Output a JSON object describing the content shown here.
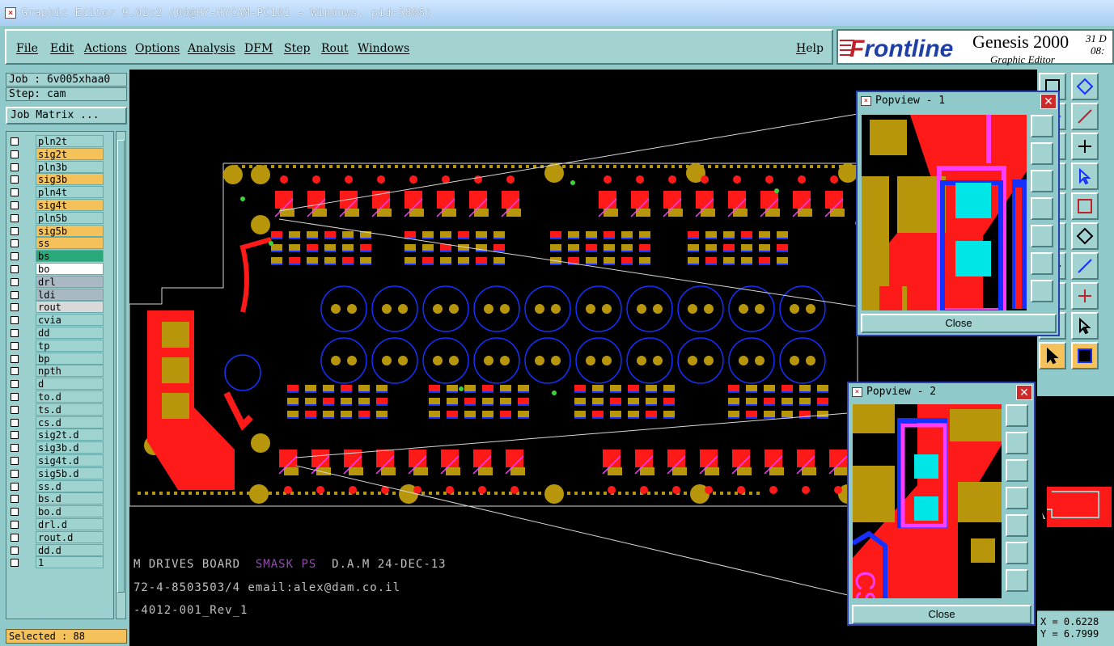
{
  "window": {
    "title": "Graphic Editor 9.02c2 (00@HY-HYCAM-PC101 - Windows, pid:5808)"
  },
  "menu": {
    "items": [
      "File",
      "Edit",
      "Actions",
      "Options",
      "Analysis",
      "DFM",
      "Step",
      "Rout",
      "Windows"
    ],
    "help": "Help"
  },
  "logo": {
    "brand_first": "F",
    "brand_rest": "rontline",
    "product": "Genesis 2000",
    "subtitle": "Graphic Editor",
    "date_line1": "31 D",
    "date_line2": "08:"
  },
  "job": {
    "job_label": "Job : 6v005xhaa0",
    "step_label": "Step: cam",
    "matrix_button": "Job Matrix ..."
  },
  "layers": [
    {
      "name": "pln2t",
      "color": "#9ed3d0"
    },
    {
      "name": "sig2t",
      "color": "#f4c15b"
    },
    {
      "name": "pln3b",
      "color": "#9ed3d0"
    },
    {
      "name": "sig3b",
      "color": "#f4c15b"
    },
    {
      "name": "pln4t",
      "color": "#9ed3d0"
    },
    {
      "name": "sig4t",
      "color": "#f4c15b"
    },
    {
      "name": "pln5b",
      "color": "#9ed3d0"
    },
    {
      "name": "sig5b",
      "color": "#f4c15b"
    },
    {
      "name": "ss",
      "color": "#f4c15b"
    },
    {
      "name": "bs",
      "color": "#2aa87a"
    },
    {
      "name": "bo",
      "color": "#ffffff"
    },
    {
      "name": "drl",
      "color": "#a9b9c4"
    },
    {
      "name": "ldi",
      "color": "#a9b9c4"
    },
    {
      "name": "rout",
      "color": "#d9d9d9"
    },
    {
      "name": "cvia",
      "color": "#9ed3d0"
    },
    {
      "name": "dd",
      "color": "#9ed3d0"
    },
    {
      "name": "tp",
      "color": "#9ed3d0"
    },
    {
      "name": "bp",
      "color": "#9ed3d0"
    },
    {
      "name": "npth",
      "color": "#9ed3d0"
    },
    {
      "name": "d",
      "color": "#9ed3d0"
    },
    {
      "name": "to.d",
      "color": "#9ed3d0"
    },
    {
      "name": "ts.d",
      "color": "#9ed3d0"
    },
    {
      "name": "cs.d",
      "color": "#9ed3d0"
    },
    {
      "name": "sig2t.d",
      "color": "#9ed3d0"
    },
    {
      "name": "sig3b.d",
      "color": "#9ed3d0"
    },
    {
      "name": "sig4t.d",
      "color": "#9ed3d0"
    },
    {
      "name": "sig5b.d",
      "color": "#9ed3d0"
    },
    {
      "name": "ss.d",
      "color": "#9ed3d0"
    },
    {
      "name": "bs.d",
      "color": "#9ed3d0"
    },
    {
      "name": "bo.d",
      "color": "#9ed3d0"
    },
    {
      "name": "drl.d",
      "color": "#9ed3d0"
    },
    {
      "name": "rout.d",
      "color": "#9ed3d0"
    },
    {
      "name": "dd.d",
      "color": "#9ed3d0"
    },
    {
      "name": "1",
      "color": "#9ed3d0"
    }
  ],
  "status": {
    "selected": "Selected : 88"
  },
  "board_text": {
    "line1": "M DRIVES BOARD",
    "line1_b": "SMASK PS",
    "line1_c": "D.A.M 24-DEC-13",
    "line2": "72-4-8503503/4 email:alex@dam.co.il",
    "line3": "-4012-001_Rev_1"
  },
  "popview1": {
    "title": "Popview - 1",
    "close": "Close"
  },
  "popview2": {
    "title": "Popview - 2",
    "close": "Close"
  },
  "coords": {
    "x": "X = 0.6228",
    "y": "Y = 6.7999"
  },
  "colors": {
    "panel": "#8fc9c9",
    "copper": "#b8960c",
    "pad_red": "#ff1a1a",
    "trace_blue": "#1530ff",
    "magenta": "#ff3dff",
    "cyan": "#00e6e6"
  }
}
